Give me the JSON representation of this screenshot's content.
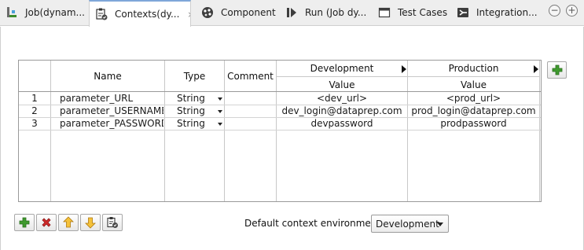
{
  "tabs": [
    {
      "label": "Job(dynam...",
      "icon": "job-icon",
      "active": false
    },
    {
      "label": "Contexts(dy...",
      "icon": "contexts-icon",
      "active": true,
      "close": "×"
    },
    {
      "label": "Component",
      "icon": "component-icon",
      "active": false
    },
    {
      "label": "Run (Job dy...",
      "icon": "run-icon",
      "active": false
    },
    {
      "label": "Test Cases",
      "icon": "test-cases-icon",
      "active": false
    },
    {
      "label": "Integration...",
      "icon": "integration-icon",
      "active": false
    }
  ],
  "window_controls": {
    "minimize": "−",
    "maximize": "+"
  },
  "table": {
    "headers": {
      "name": "Name",
      "type": "Type",
      "comment": "Comment",
      "env1": "Development",
      "env2": "Production",
      "value1": "Value",
      "value2": "Value"
    },
    "rows": [
      {
        "num": "1",
        "name": "parameter_URL",
        "type": "String",
        "comment": "",
        "dev": "<dev_url>",
        "prod": "<prod_url>"
      },
      {
        "num": "2",
        "name": "parameter_USERNAME",
        "type": "String",
        "comment": "",
        "dev": "dev_login@dataprep.com",
        "prod": "prod_login@dataprep.com"
      },
      {
        "num": "3",
        "name": "parameter_PASSWORD",
        "type": "String",
        "comment": "",
        "dev": "devpassword",
        "prod": "prodpassword"
      }
    ]
  },
  "toolbar": {
    "buttons": [
      "add-icon",
      "remove-icon",
      "move-up-icon",
      "move-down-icon",
      "context-icon"
    ]
  },
  "default_env": {
    "label": "Default context environment",
    "value": "Development"
  },
  "colors": {
    "accent_tab": "#7fa7d9",
    "add_green": "#3f9a2e",
    "remove_red": "#d12a2a",
    "arrow_orange": "#e8a31c"
  }
}
